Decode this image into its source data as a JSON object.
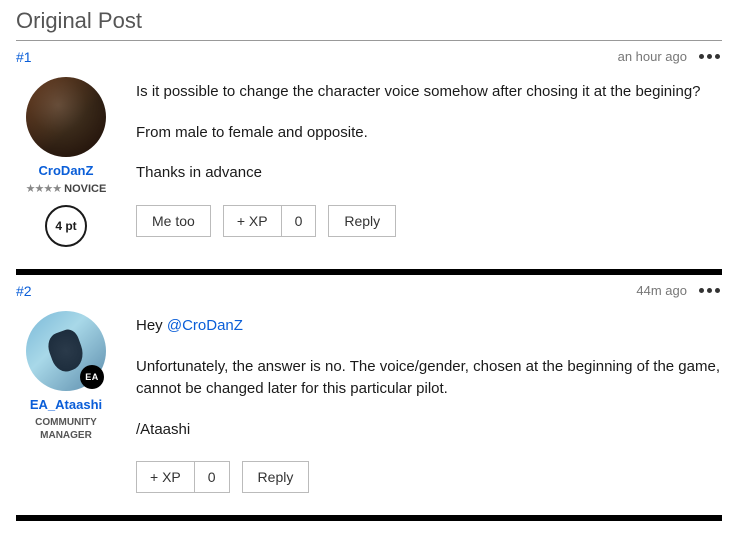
{
  "section_title": "Original Post",
  "posts": [
    {
      "number": "#1",
      "timestamp": "an hour ago",
      "user": {
        "name": "CroDanZ",
        "rank": "NOVICE",
        "points": "4 pt"
      },
      "body": {
        "p1": "Is it possible to change the character voice somehow after chosing it at the begining?",
        "p2": "From male to female and opposite.",
        "p3": "Thanks in advance"
      },
      "actions": {
        "metoo": "Me too",
        "xp": "+ XP",
        "xp_count": "0",
        "reply": "Reply"
      }
    },
    {
      "number": "#2",
      "timestamp": "44m ago",
      "user": {
        "name": "EA_Ataashi",
        "role": "COMMUNITY MANAGER",
        "badge": "EA"
      },
      "body": {
        "greeting": "Hey ",
        "mention": "@CroDanZ",
        "p2": "Unfortunately, the answer is no. The voice/gender, chosen at the beginning of the game, cannot be changed later for this particular pilot.",
        "p3": "/Ataashi"
      },
      "actions": {
        "xp": "+ XP",
        "xp_count": "0",
        "reply": "Reply"
      }
    }
  ]
}
